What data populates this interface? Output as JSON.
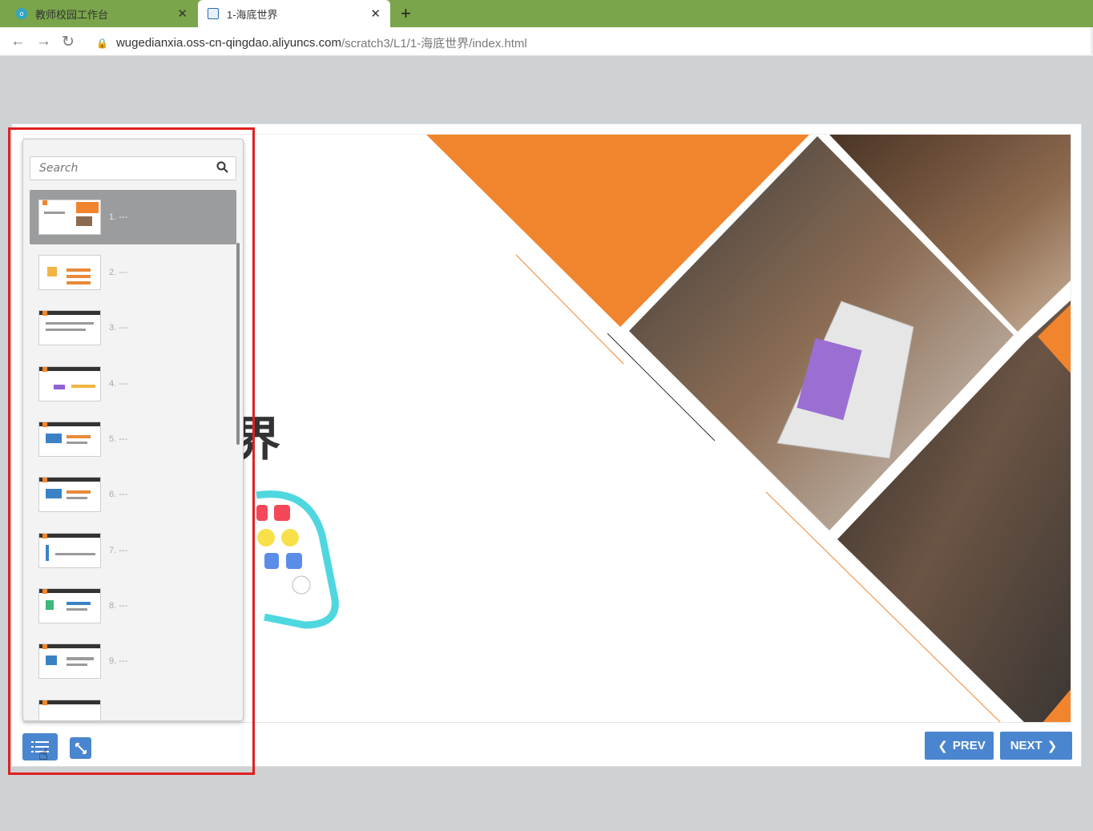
{
  "browser": {
    "tabs": [
      {
        "title": "教师校园工作台",
        "active": false
      },
      {
        "title": "1-海底世界",
        "active": true
      }
    ],
    "url": {
      "host": "wugedianxia.oss-cn-qingdao.aliyuncs.com",
      "path": "/scratch3/L1/1-海底世界/index.html"
    }
  },
  "slide": {
    "title_fragment": "界"
  },
  "menu": {
    "search_placeholder": "Search",
    "items": [
      {
        "label": "1. ---",
        "selected": true
      },
      {
        "label": "2. ---"
      },
      {
        "label": "3. ---"
      },
      {
        "label": "4. ---"
      },
      {
        "label": "5. ---"
      },
      {
        "label": "6. ---"
      },
      {
        "label": "7. ---"
      },
      {
        "label": "8. ---"
      },
      {
        "label": "9. ---"
      },
      {
        "label": ""
      }
    ]
  },
  "controls": {
    "prev_label": "PREV",
    "next_label": "NEXT"
  },
  "colors": {
    "accent": "#4a86cf",
    "orange": "#f0852d",
    "tabbar": "#7aa54a",
    "highlight": "#e02020"
  },
  "icons": {
    "menu_toggle": "list-icon",
    "fullscreen": "expand-icon",
    "search": "search-icon"
  }
}
